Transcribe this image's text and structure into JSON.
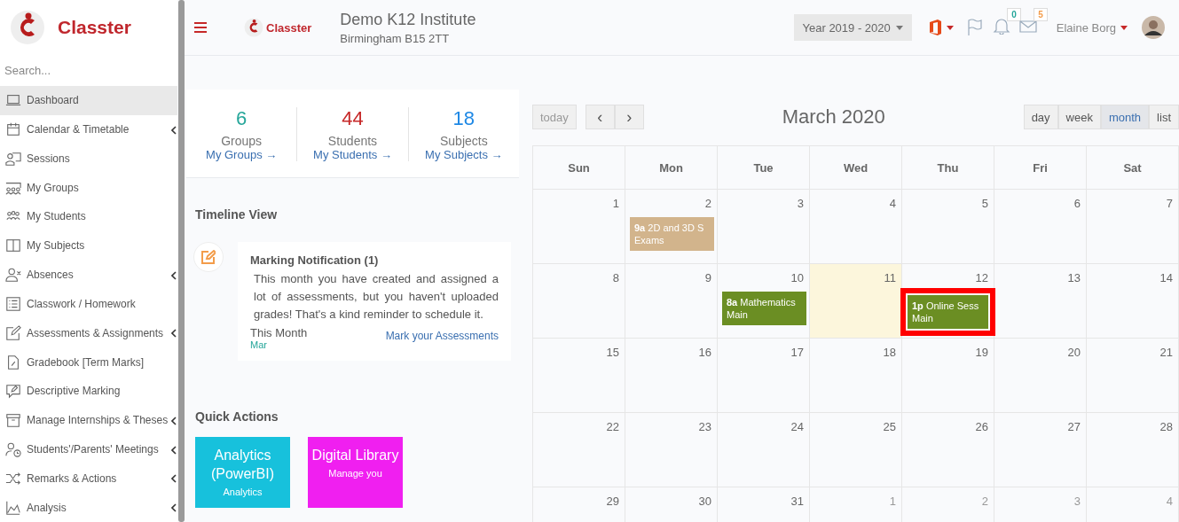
{
  "sidebar": {
    "brand": "Classter",
    "search": {
      "placeholder": "Search..."
    },
    "items": [
      {
        "label": "Dashboard",
        "selected": true,
        "has_submenu": false
      },
      {
        "label": "Calendar & Timetable",
        "selected": false,
        "has_submenu": true
      },
      {
        "label": "Sessions",
        "selected": false,
        "has_submenu": false
      },
      {
        "label": "My Groups",
        "selected": false,
        "has_submenu": false
      },
      {
        "label": "My Students",
        "selected": false,
        "has_submenu": false
      },
      {
        "label": "My Subjects",
        "selected": false,
        "has_submenu": false
      },
      {
        "label": "Absences",
        "selected": false,
        "has_submenu": true
      },
      {
        "label": "Classwork / Homework",
        "selected": false,
        "has_submenu": false
      },
      {
        "label": "Assessments & Assignments",
        "selected": false,
        "has_submenu": true
      },
      {
        "label": "Gradebook [Term Marks]",
        "selected": false,
        "has_submenu": false
      },
      {
        "label": "Descriptive Marking",
        "selected": false,
        "has_submenu": false
      },
      {
        "label": "Manage Internships & Theses",
        "selected": false,
        "has_submenu": true
      },
      {
        "label": "Students'/Parents' Meetings",
        "selected": false,
        "has_submenu": true
      },
      {
        "label": "Remarks & Actions",
        "selected": false,
        "has_submenu": true
      },
      {
        "label": "Analysis",
        "selected": false,
        "has_submenu": true
      }
    ]
  },
  "header": {
    "brand": "Classter",
    "institute": "Demo K12 Institute",
    "address": "Birmingham B15 2TT",
    "year": "Year 2019 - 2020",
    "notifications": "0",
    "messages": "5",
    "user": "Elaine Borg"
  },
  "stats": [
    {
      "value": "6",
      "label": "Groups",
      "link": "My Groups →",
      "color": "#26a69a"
    },
    {
      "value": "44",
      "label": "Students",
      "link": "My Students →",
      "color": "#c62828"
    },
    {
      "value": "18",
      "label": "Subjects",
      "link": "My Subjects →",
      "color": "#1e88e5"
    }
  ],
  "timeline": {
    "title": "Timeline View",
    "items": [
      {
        "title": "Marking Notification (1)",
        "text": "This month you have created and assigned a lot of assessments, but you haven't uploaded grades! That's a kind reminder to schedule it.",
        "period": "This Month",
        "month": "Mar",
        "link": "Mark your Assessments"
      }
    ]
  },
  "quick_actions": {
    "title": "Quick Actions",
    "items": [
      {
        "title": "Analytics (PowerBI)",
        "subtitle": "Analytics",
        "color": "#17c1dc"
      },
      {
        "title": "Digital Library",
        "subtitle": "Manage you",
        "color": "#f01ff0"
      }
    ]
  },
  "calendar": {
    "title": "March 2020",
    "today_button": "today",
    "prev": "‹",
    "next": "›",
    "views": [
      {
        "label": "day",
        "selected": false
      },
      {
        "label": "week",
        "selected": false
      },
      {
        "label": "month",
        "selected": true
      },
      {
        "label": "list",
        "selected": false
      }
    ],
    "weekdays": [
      "Sun",
      "Mon",
      "Tue",
      "Wed",
      "Thu",
      "Fri",
      "Sat"
    ],
    "weeks": [
      [
        {
          "day": "1",
          "other_month": false,
          "today": false
        },
        {
          "day": "2",
          "other_month": false,
          "today": false,
          "events": [
            {
              "time": "9a",
              "title": "2D and 3D S",
              "subtitle": "Exams",
              "color": "#d2b48c",
              "highlighted": false
            }
          ]
        },
        {
          "day": "3",
          "other_month": false,
          "today": false
        },
        {
          "day": "4",
          "other_month": false,
          "today": false
        },
        {
          "day": "5",
          "other_month": false,
          "today": false
        },
        {
          "day": "6",
          "other_month": false,
          "today": false
        },
        {
          "day": "7",
          "other_month": false,
          "today": false
        }
      ],
      [
        {
          "day": "8",
          "other_month": false,
          "today": false
        },
        {
          "day": "9",
          "other_month": false,
          "today": false
        },
        {
          "day": "10",
          "other_month": false,
          "today": false,
          "events": [
            {
              "time": "8a",
              "title": "Mathematics",
              "subtitle": "Main",
              "color": "#6b8e23",
              "highlighted": false
            }
          ]
        },
        {
          "day": "11",
          "other_month": false,
          "today": true
        },
        {
          "day": "12",
          "other_month": false,
          "today": false,
          "events": [
            {
              "time": "1p",
              "title": "Online Sess",
              "subtitle": "Main",
              "color": "#6b8e23",
              "highlighted": true
            }
          ]
        },
        {
          "day": "13",
          "other_month": false,
          "today": false
        },
        {
          "day": "14",
          "other_month": false,
          "today": false
        }
      ],
      [
        {
          "day": "15",
          "other_month": false,
          "today": false
        },
        {
          "day": "16",
          "other_month": false,
          "today": false
        },
        {
          "day": "17",
          "other_month": false,
          "today": false
        },
        {
          "day": "18",
          "other_month": false,
          "today": false
        },
        {
          "day": "19",
          "other_month": false,
          "today": false
        },
        {
          "day": "20",
          "other_month": false,
          "today": false
        },
        {
          "day": "21",
          "other_month": false,
          "today": false
        }
      ],
      [
        {
          "day": "22",
          "other_month": false,
          "today": false
        },
        {
          "day": "23",
          "other_month": false,
          "today": false
        },
        {
          "day": "24",
          "other_month": false,
          "today": false
        },
        {
          "day": "25",
          "other_month": false,
          "today": false
        },
        {
          "day": "26",
          "other_month": false,
          "today": false
        },
        {
          "day": "27",
          "other_month": false,
          "today": false
        },
        {
          "day": "28",
          "other_month": false,
          "today": false
        }
      ],
      [
        {
          "day": "29",
          "other_month": false,
          "today": false
        },
        {
          "day": "30",
          "other_month": false,
          "today": false
        },
        {
          "day": "31",
          "other_month": false,
          "today": false
        },
        {
          "day": "1",
          "other_month": true,
          "today": false
        },
        {
          "day": "2",
          "other_month": true,
          "today": false
        },
        {
          "day": "3",
          "other_month": true,
          "today": false
        },
        {
          "day": "4",
          "other_month": true,
          "today": false
        }
      ]
    ]
  }
}
